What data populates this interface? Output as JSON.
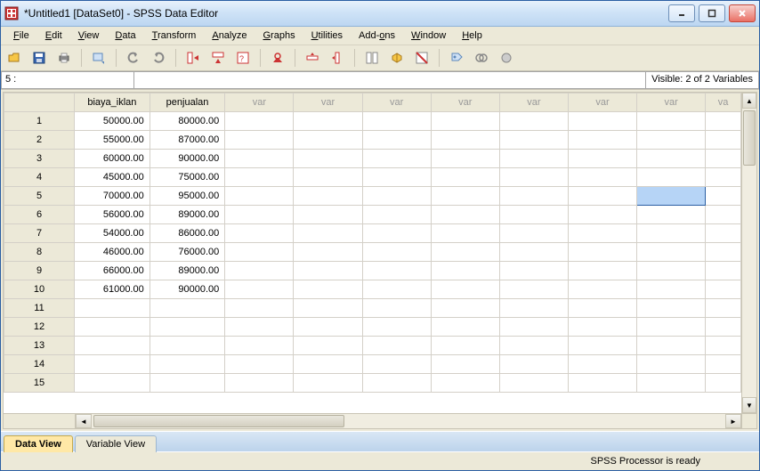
{
  "window": {
    "title": "*Untitled1 [DataSet0] - SPSS Data Editor"
  },
  "menus": {
    "file": "File",
    "edit": "Edit",
    "view": "View",
    "data": "Data",
    "transform": "Transform",
    "analyze": "Analyze",
    "graphs": "Graphs",
    "utilities": "Utilities",
    "addons": "Add-ons",
    "window": "Window",
    "help": "Help"
  },
  "inputbar": {
    "cellref": "5 :",
    "editvalue": "",
    "visible": "Visible: 2 of 2 Variables"
  },
  "columns": {
    "c1": "biaya_iklan",
    "c2": "penjualan",
    "empty": "var"
  },
  "rows": [
    {
      "n": "1",
      "c1": "50000.00",
      "c2": "80000.00"
    },
    {
      "n": "2",
      "c1": "55000.00",
      "c2": "87000.00"
    },
    {
      "n": "3",
      "c1": "60000.00",
      "c2": "90000.00"
    },
    {
      "n": "4",
      "c1": "45000.00",
      "c2": "75000.00"
    },
    {
      "n": "5",
      "c1": "70000.00",
      "c2": "95000.00"
    },
    {
      "n": "6",
      "c1": "56000.00",
      "c2": "89000.00"
    },
    {
      "n": "7",
      "c1": "54000.00",
      "c2": "86000.00"
    },
    {
      "n": "8",
      "c1": "46000.00",
      "c2": "76000.00"
    },
    {
      "n": "9",
      "c1": "66000.00",
      "c2": "89000.00"
    },
    {
      "n": "10",
      "c1": "61000.00",
      "c2": "90000.00"
    },
    {
      "n": "11",
      "c1": "",
      "c2": ""
    },
    {
      "n": "12",
      "c1": "",
      "c2": ""
    },
    {
      "n": "13",
      "c1": "",
      "c2": ""
    },
    {
      "n": "14",
      "c1": "",
      "c2": ""
    },
    {
      "n": "15",
      "c1": "",
      "c2": ""
    }
  ],
  "tabs": {
    "dataview": "Data View",
    "varview": "Variable View"
  },
  "status": {
    "msg": "SPSS Processor is ready"
  },
  "selected": {
    "row": 5,
    "colIndex": 9
  }
}
